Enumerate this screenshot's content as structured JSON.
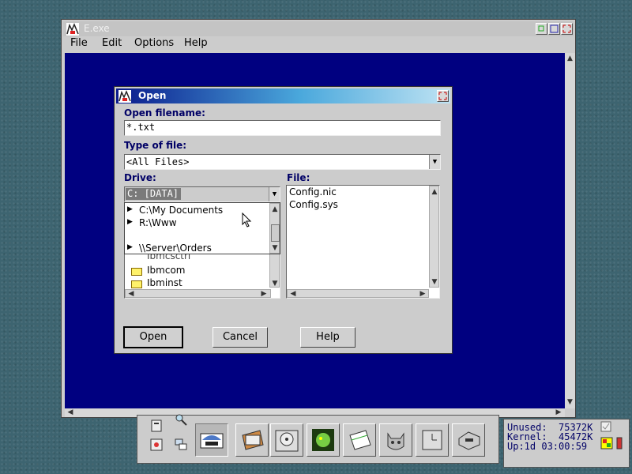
{
  "window": {
    "title": "E.exe",
    "menu": [
      "File",
      "Edit",
      "Options",
      "Help"
    ]
  },
  "dialog": {
    "title": "Open",
    "filename_label": "Open filename:",
    "filename_value": "*.txt",
    "type_label": "Type of file:",
    "type_value": "<All Files>",
    "drive_label": "Drive:",
    "drive_value": "C:  [DATA]",
    "drive_options": [
      "C:\\My Documents",
      "R:\\Www",
      "\\\\Server\\Orders"
    ],
    "dir_items": [
      "Ibmcom",
      "Ibminst"
    ],
    "partial_dir": "Ibmcsctrl",
    "file_label": "File:",
    "files": [
      "Config.nic",
      "Config.sys"
    ],
    "buttons": {
      "open": "Open",
      "cancel": "Cancel",
      "help": "Help"
    }
  },
  "sysinfo": {
    "unused": "Unused:  75372K",
    "kernel": "Kernel:  45472K",
    "uptime": "Up:1d 03:00:59"
  }
}
